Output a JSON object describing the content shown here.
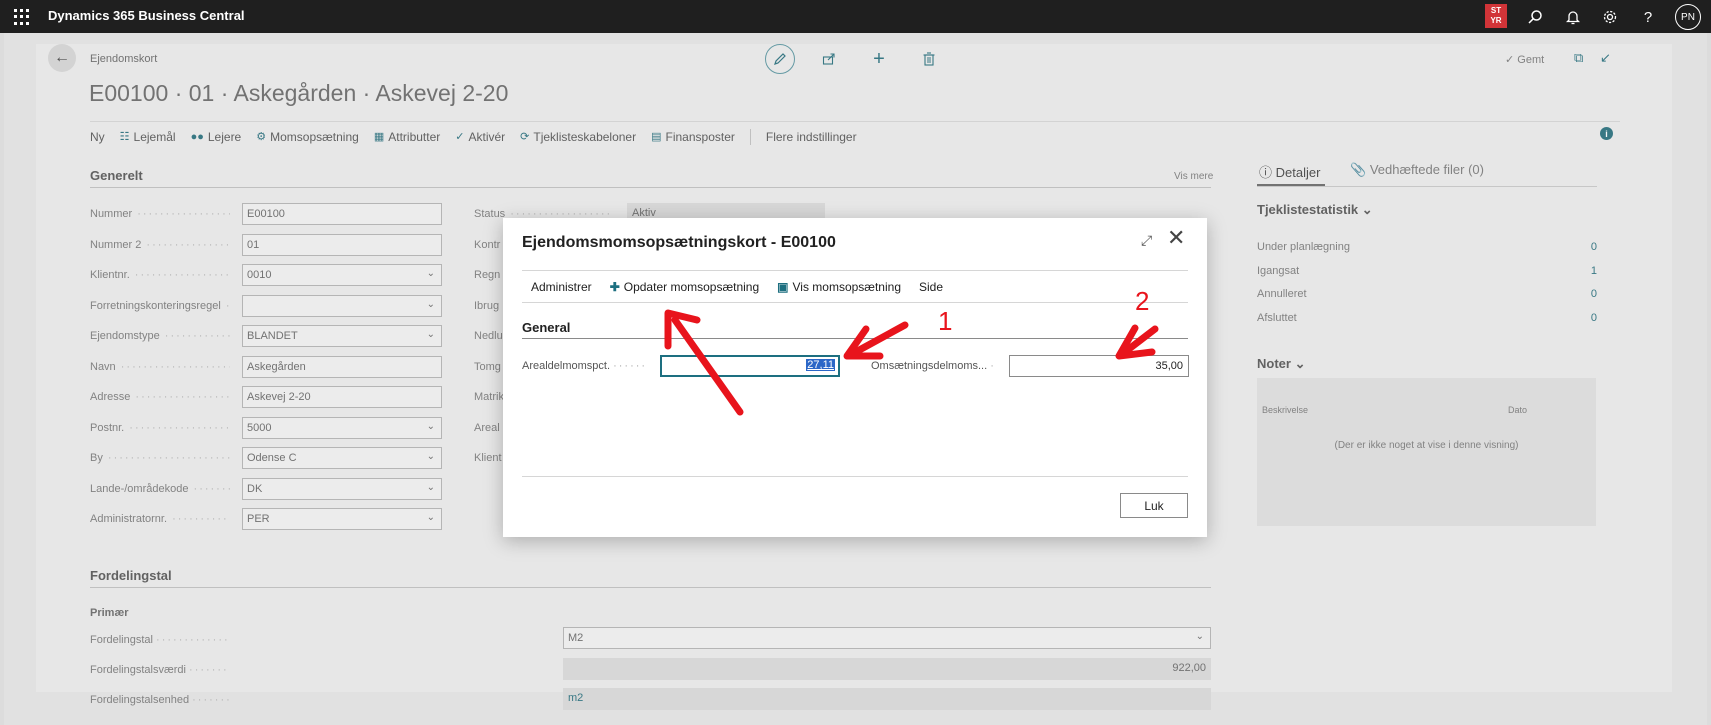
{
  "topbar": {
    "brand": "Dynamics 365 Business Central",
    "badge_line1": "ST",
    "badge_line2": "YR",
    "avatar": "PN",
    "icons": [
      "waffle-icon",
      "search-icon",
      "bell-icon",
      "gear-icon",
      "help-icon"
    ]
  },
  "page": {
    "breadcrumb": "Ejendomskort",
    "title": "E00100 · 01 · Askegården · Askevej 2-20",
    "saved": "Gemt",
    "actions": [
      {
        "label": "Ny",
        "icon": ""
      },
      {
        "label": "Lejemål",
        "icon": "hierarchy-icon"
      },
      {
        "label": "Lejere",
        "icon": "people-icon"
      },
      {
        "label": "Momsopsætning",
        "icon": "settings-icon"
      },
      {
        "label": "Attributter",
        "icon": "columns-icon"
      },
      {
        "label": "Aktivér",
        "icon": "check-icon"
      },
      {
        "label": "Tjeklisteskabeloner",
        "icon": "checklist-icon"
      },
      {
        "label": "Finansposter",
        "icon": "ledger-icon"
      }
    ],
    "more_options": "Flere indstillinger"
  },
  "general": {
    "title": "Generelt",
    "show_more": "Vis mere",
    "fields": [
      {
        "label": "Nummer",
        "value": "E00100",
        "dropdown": false
      },
      {
        "label": "Nummer 2",
        "value": "01",
        "dropdown": false
      },
      {
        "label": "Klientnr.",
        "value": "0010",
        "dropdown": true
      },
      {
        "label": "Forretningskonteringsregel",
        "value": "",
        "dropdown": true
      },
      {
        "label": "Ejendomstype",
        "value": "BLANDET",
        "dropdown": true
      },
      {
        "label": "Navn",
        "value": "Askegården",
        "dropdown": false
      },
      {
        "label": "Adresse",
        "value": "Askevej 2-20",
        "dropdown": false
      },
      {
        "label": "Postnr.",
        "value": "5000",
        "dropdown": true
      },
      {
        "label": "By",
        "value": "Odense C",
        "dropdown": true
      },
      {
        "label": "Lande-/områdekode",
        "value": "DK",
        "dropdown": true
      },
      {
        "label": "Administratornr.",
        "value": "PER",
        "dropdown": true
      }
    ],
    "col2_labels": [
      "Status",
      "Kontr",
      "Regn",
      "Ibrug",
      "Nedlu",
      "Tomg",
      "Matrik",
      "Areal",
      "Klient"
    ],
    "status_value": "Aktiv"
  },
  "distribution": {
    "title": "Fordelingstal",
    "subtitle": "Primær",
    "rows": [
      {
        "label": "Fordelingstal",
        "value": "M2"
      },
      {
        "label": "Fordelingstalsværdi",
        "value": "922,00"
      },
      {
        "label": "Fordelingstalsenhed",
        "value": "m2"
      }
    ]
  },
  "factbox": {
    "tab_details": "Detaljer",
    "tab_files": "Vedhæftede filer (0)",
    "checklist_title": "Tjeklistestatistik",
    "stats": [
      {
        "label": "Under planlægning",
        "value": "0"
      },
      {
        "label": "Igangsat",
        "value": "1"
      },
      {
        "label": "Annulleret",
        "value": "0"
      },
      {
        "label": "Afsluttet",
        "value": "0"
      }
    ],
    "notes_title": "Noter",
    "notes_col1": "Beskrivelse",
    "notes_col2": "Dato",
    "notes_empty": "(Der er ikke noget at vise i denne visning)"
  },
  "dialog": {
    "title": "Ejendomsmomsopsætningskort - E00100",
    "actions": [
      {
        "label": "Administrer",
        "icon": ""
      },
      {
        "label": "Opdater momsopsætning",
        "icon": "plus-icon"
      },
      {
        "label": "Vis momsopsætning",
        "icon": "view-icon"
      },
      {
        "label": "Side",
        "icon": ""
      }
    ],
    "section": "General",
    "field1_label": "Arealdelmomspct.",
    "field1_value": "27,11",
    "field2_label": "Omsætningsdelmoms...",
    "field2_value": "35,00",
    "close_button": "Luk"
  },
  "annotations": {
    "label1": "1",
    "label2": "2",
    "color": "#e8141c"
  }
}
